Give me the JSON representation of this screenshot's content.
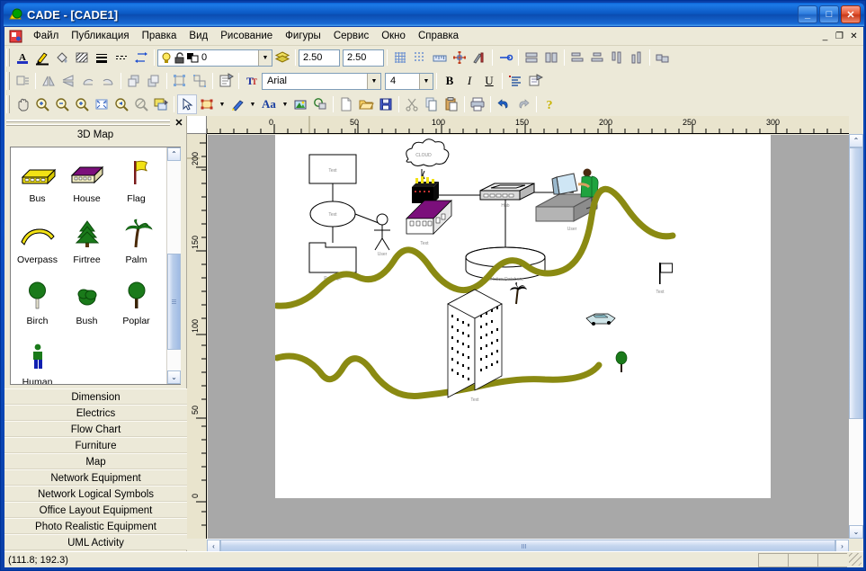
{
  "window": {
    "title": "CADE - [CADE1]",
    "app_icon": "cade-logo-icon",
    "minimize": "_",
    "maximize": "□",
    "close": "✕"
  },
  "mdi": {
    "minimize": "_",
    "restore": "❐",
    "close": "✕"
  },
  "menubar": {
    "system_icon": "document-system-icon",
    "items": [
      {
        "label": "Файл",
        "name": "menu-file"
      },
      {
        "label": "Публикация",
        "name": "menu-publication"
      },
      {
        "label": "Правка",
        "name": "menu-edit"
      },
      {
        "label": "Вид",
        "name": "menu-view"
      },
      {
        "label": "Рисование",
        "name": "menu-draw"
      },
      {
        "label": "Фигуры",
        "name": "menu-shapes"
      },
      {
        "label": "Сервис",
        "name": "menu-service"
      },
      {
        "label": "Окно",
        "name": "menu-window"
      },
      {
        "label": "Справка",
        "name": "menu-help"
      }
    ]
  },
  "toolbars": {
    "row1": {
      "icons": [
        "font-color-icon",
        "pen-color-icon",
        "fill-color-icon",
        "hatch-pattern-icon",
        "line-weight-icon",
        "line-style-icon",
        "line-ends-icon"
      ],
      "layer_value": "0",
      "layer_dropdown_arrow": "▼",
      "layers_icon": "layers-icon",
      "field1": "2.50",
      "field2": "2.50",
      "icons2": [
        "grid-icon",
        "snap-grid-icon",
        "ruler-icon",
        "snap-point-icon",
        "drawing-tools-icon"
      ],
      "icons3": [
        "connector-icon",
        "group-icon",
        "ungroup-icon",
        "align-left-icon",
        "align-center-icon",
        "align-top-icon",
        "align-bottom-icon",
        "distribute-icon"
      ]
    },
    "row2": {
      "icons": [
        "order-icon",
        "flip-horizontal-icon",
        "flip-vertical-icon",
        "rotate-left-icon",
        "rotate-right-icon",
        "bring-front-icon",
        "send-back-icon",
        "group-shapes-icon",
        "ungroup-shapes-icon",
        "properties-icon"
      ],
      "font_icon": "font-icon",
      "font_name": "Arial",
      "font_dropdown_arrow": "▼",
      "font_size": "4",
      "size_dropdown_arrow": "▼",
      "bold": "B",
      "italic": "I",
      "underline": "U",
      "icons2": [
        "paragraph-align-icon",
        "text-properties-icon"
      ]
    },
    "row3": {
      "icons": [
        "pan-hand-icon",
        "zoom-in-icon",
        "zoom-out-icon",
        "zoom-window-icon",
        "zoom-fit-icon",
        "zoom-previous-icon",
        "zoom-selection-icon",
        "fit-page-icon"
      ],
      "icons2": [
        "pointer-icon",
        "rectangle-tool-icon",
        "rectangle-dropdown-icon",
        "pen-tool-icon",
        "pen-dropdown-icon",
        "text-tool-icon",
        "text-dropdown-icon",
        "image-tool-icon",
        "shape-tool-icon"
      ],
      "icons3": [
        "new-file-icon",
        "open-file-icon",
        "save-file-icon",
        "cut-icon",
        "copy-icon",
        "paste-icon",
        "print-icon",
        "undo-icon",
        "redo-icon",
        "help-icon"
      ],
      "aa_label": "Aa",
      "dropdown_arrow": "▼"
    }
  },
  "stencil_panel": {
    "close_label": "✕",
    "caption": "3D Map",
    "shapes": [
      {
        "label": "Bus",
        "icon": "bus-shape-icon"
      },
      {
        "label": "House",
        "icon": "house-shape-icon"
      },
      {
        "label": "Flag",
        "icon": "flag-shape-icon"
      },
      {
        "label": "Overpass",
        "icon": "overpass-shape-icon"
      },
      {
        "label": "Firtree",
        "icon": "firtree-shape-icon"
      },
      {
        "label": "Palm",
        "icon": "palm-shape-icon"
      },
      {
        "label": "Birch",
        "icon": "birch-shape-icon"
      },
      {
        "label": "Bush",
        "icon": "bush-shape-icon"
      },
      {
        "label": "Poplar",
        "icon": "poplar-shape-icon"
      },
      {
        "label": "Human",
        "icon": "human-shape-icon"
      }
    ],
    "scroll_up": "⌃",
    "scroll_down": "⌄"
  },
  "categories": [
    {
      "label": "Dimension",
      "name": "category-dimension"
    },
    {
      "label": "Electrics",
      "name": "category-electrics"
    },
    {
      "label": "Flow Chart",
      "name": "category-flow-chart"
    },
    {
      "label": "Furniture",
      "name": "category-furniture"
    },
    {
      "label": "Map",
      "name": "category-map"
    },
    {
      "label": "Network Equipment",
      "name": "category-network-equipment"
    },
    {
      "label": "Network Logical Symbols",
      "name": "category-network-logical-symbols"
    },
    {
      "label": "Office Layout Equipment",
      "name": "category-office-layout-equipment"
    },
    {
      "label": "Photo Realistic Equipment",
      "name": "category-photo-realistic-equipment"
    },
    {
      "label": "UML Activity",
      "name": "category-uml-activity"
    }
  ],
  "rulers": {
    "horizontal_labels": [
      "0",
      "50",
      "100",
      "150",
      "200",
      "250",
      "300"
    ],
    "vertical_labels": [
      "200",
      "150",
      "100",
      "50",
      "0"
    ]
  },
  "canvas": {
    "diagram_labels": {
      "text_box": "Text",
      "text_ellipse": "Text",
      "package": "Package",
      "actor_user": "User",
      "cloud": "CLOUD",
      "hub": "Hub",
      "database": "Relation Database",
      "desk_user": "User",
      "map_house": "Text",
      "map_building": "Text",
      "map_flag": "Text"
    },
    "colors": {
      "road": "#8a8a12",
      "roof": "#7b0f7b",
      "house_wall": "#ffffff",
      "tree_green": "#1a7a1a",
      "bus_yellow": "#f2e215"
    }
  },
  "statusbar": {
    "coordinates": "(111.8; 192.3)"
  }
}
